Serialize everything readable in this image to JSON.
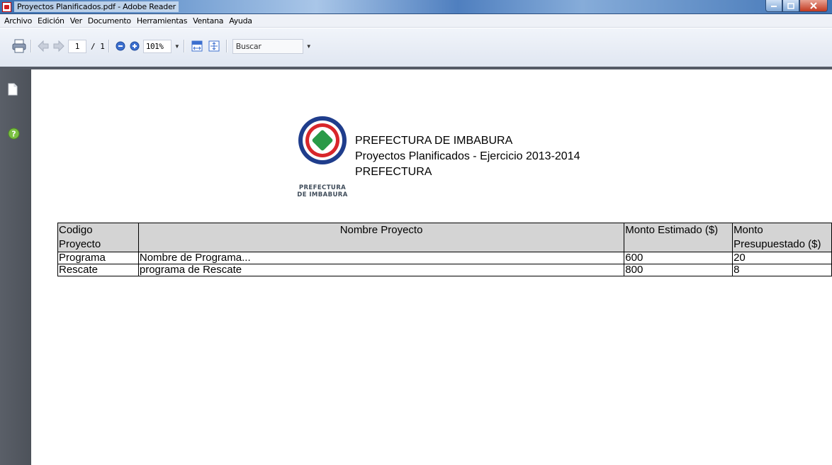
{
  "window": {
    "title": "Proyectos Planificados.pdf - Adobe Reader",
    "controls": [
      "minimize",
      "maximize",
      "close"
    ]
  },
  "menu": {
    "items": [
      "Archivo",
      "Edición",
      "Ver",
      "Documento",
      "Herramientas",
      "Ventana",
      "Ayuda"
    ]
  },
  "toolbar": {
    "page_current": "1",
    "page_total": "/ 1",
    "zoom": "101%",
    "search_placeholder": "Buscar",
    "icons": [
      "printer-icon",
      "previous-page-icon",
      "next-page-icon",
      "zoom-out-icon",
      "zoom-in-icon",
      "fit-page-icon",
      "fit-width-icon"
    ]
  },
  "navpanel": {
    "icons": [
      "pages-icon",
      "help-icon"
    ]
  },
  "document": {
    "logo_caption_line1": "PREFECTURA",
    "logo_caption_line2": "DE IMBABURA",
    "header_line1": "PREFECTURA DE IMBABURA",
    "header_line2": "Proyectos Planificados - Ejercicio 2013-2014",
    "header_line3": "PREFECTURA",
    "table": {
      "headers": {
        "code_line1": "Codigo",
        "code_line2": "Proyecto",
        "name": "Nombre Proyecto",
        "estimated": "Monto Estimado ($)",
        "budget_line1": "Monto",
        "budget_line2": "Presupuestado ($)"
      },
      "rows": [
        {
          "code": "Programa",
          "name": "Nombre de Programa...",
          "estimated": "600",
          "budget": "20"
        },
        {
          "code": "Rescate",
          "name": "programa de Rescate",
          "estimated": "800",
          "budget": "8"
        }
      ]
    }
  },
  "colors": {
    "logo_blue": "#1f3d8c",
    "logo_red": "#d8262a",
    "logo_green": "#2a9a48",
    "header_bg": "#d4d4d4",
    "panel_dark": "#555b66"
  }
}
